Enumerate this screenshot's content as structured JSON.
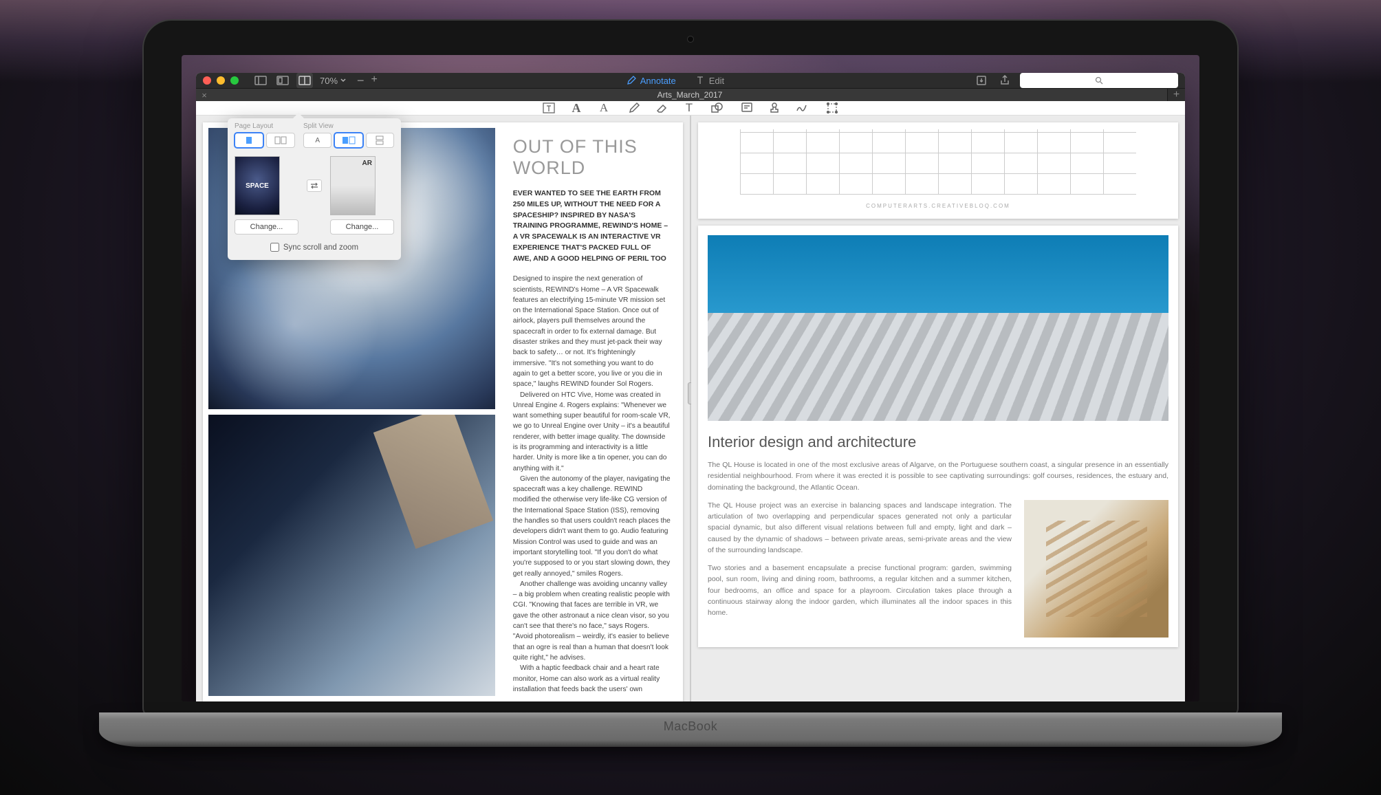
{
  "window": {
    "zoom_level": "70%",
    "annotate_label": "Annotate",
    "edit_label": "Edit",
    "search_placeholder": ""
  },
  "tab": {
    "title": "Arts_March_2017"
  },
  "popover": {
    "page_layout_label": "Page Layout",
    "split_view_label": "Split View",
    "change_label": "Change...",
    "sync_label": "Sync scroll and zoom",
    "thumb_left": "SPACE",
    "thumb_right": "AR"
  },
  "article_left": {
    "title": "OUT OF THIS WORLD",
    "lede": "EVER WANTED TO SEE THE EARTH FROM 250 MILES UP, WITHOUT THE NEED FOR A SPACESHIP? INSPIRED BY NASA'S TRAINING PROGRAMME, REWIND'S HOME – A VR SPACEWALK IS AN INTERACTIVE VR EXPERIENCE THAT'S PACKED FULL OF AWE, AND A GOOD HELPING OF PERIL TOO",
    "body_p1": "Designed to inspire the next generation of scientists, REWIND's Home – A VR Spacewalk features an electrifying 15-minute VR mission set on the International Space Station. Once out of airlock, players pull themselves around the spacecraft in order to fix external damage. But disaster strikes and they must jet-pack their way back to safety… or not. It's frighteningly immersive. \"It's not something you want to do again to get a better score, you live or you die in space,\" laughs REWIND founder Sol Rogers.",
    "body_p2": "Delivered on HTC Vive, Home was created in Unreal Engine 4. Rogers explains: \"Whenever we want something super beautiful for room-scale VR, we go to Unreal Engine over Unity – it's a beautiful renderer, with better image quality. The downside is its programming and interactivity is a little harder. Unity is more like a tin opener, you can do anything with it.\"",
    "body_p3": "Given the autonomy of the player, navigating the spacecraft was a key challenge. REWIND modified the otherwise very life-like CG version of the International Space Station (ISS), removing the handles so that users couldn't reach places the developers didn't want them to go. Audio featuring Mission Control was used to guide and was an important storytelling tool. \"If you don't do what you're supposed to or you start slowing down, they get really annoyed,\" smiles Rogers.",
    "body_p4": "Another challenge was avoiding uncanny valley – a big problem when creating realistic people with CGI. \"Knowing that faces are terrible in VR, we gave the other astronaut a nice clean visor, so you can't see that there's no face,\" says Rogers. \"Avoid photorealism – weirdly, it's easier to believe that an ogre is real than a human that doesn't look quite right,\" he advises.",
    "body_p5": "With a haptic feedback chair and a heart rate monitor, Home can also work as a virtual reality installation that feeds back the users' own"
  },
  "article_right": {
    "caption": "COMPUTERARTS.CREATIVEBLOQ.COM",
    "title": "Interior design and architecture",
    "para1": "The QL House is located in one of the most exclusive areas of Algarve, on the Portuguese southern coast, a singular presence in an essentially residential neighbourhood. From where it was erected it is possible to see captivating surroundings: golf courses, residences, the estuary and, dominating the background, the Atlantic Ocean.",
    "para2": "The QL House project was an exercise in balancing spaces and landscape integration. The articulation of two overlapping and perpendicular spaces generated not only a particular spacial dynamic, but also different visual relations between full and empty, light and dark – caused by the dynamic of shadows – between private areas, semi-private areas and the view of the surrounding landscape.",
    "para3": "Two stories and a basement encapsulate a precise functional program: garden, swimming pool, sun room, living and dining room, bathrooms, a regular kitchen and a summer kitchen, four bedrooms, an office and space for a playroom. Circulation takes place through a continuous stairway along the indoor garden, which illuminates all the indoor spaces in this home."
  },
  "laptop": {
    "brand": "MacBook"
  }
}
